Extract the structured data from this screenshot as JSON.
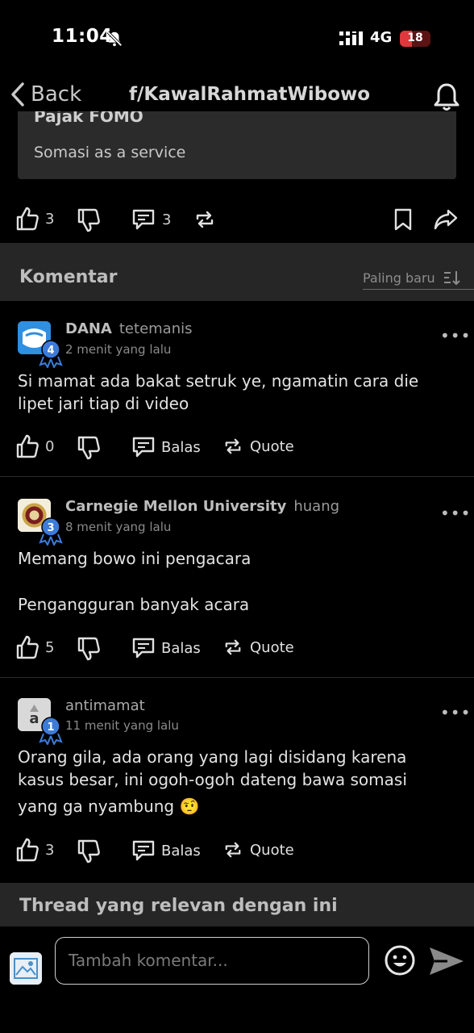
{
  "status": {
    "time": "11:04",
    "network": "4G",
    "battery": "18"
  },
  "nav": {
    "back_label": "Back",
    "title": "f/KawalRahmatWibowo"
  },
  "post": {
    "card_title_cut": "Pajak FOMO",
    "card_text": "Somasi as a service",
    "likes": "3",
    "comments": "3"
  },
  "comments_section": {
    "title": "Komentar",
    "sort_label": "Paling baru"
  },
  "comments": [
    {
      "author": "DANA",
      "username": "tetemanis",
      "time": "2 menit yang lalu",
      "badge_level": "4",
      "body": [
        "Si mamat ada bakat setruk ye, ngamatin cara die",
        "lipet jari tiap di video"
      ],
      "likes": "0",
      "reply_label": "Balas",
      "quote_label": "Quote"
    },
    {
      "author": "Carnegie Mellon University",
      "username": "huang",
      "time": "8 menit yang lalu",
      "badge_level": "3",
      "body": [
        "Memang bowo ini pengacara",
        "Pengangguran banyak acara"
      ],
      "likes": "5",
      "reply_label": "Balas",
      "quote_label": "Quote"
    },
    {
      "author": "",
      "username": "antimamat",
      "avatar_letter": "a",
      "time": "11 menit yang lalu",
      "badge_level": "1",
      "body": [
        "Orang gila, ada orang yang lagi disidang karena",
        "kasus besar, ini ogoh-ogoh dateng bawa somasi",
        "yang ga nyambung 🤨"
      ],
      "likes": "3",
      "reply_label": "Balas",
      "quote_label": "Quote"
    }
  ],
  "related": {
    "title": "Thread yang relevan dengan ini"
  },
  "composer": {
    "placeholder": "Tambah komentar..."
  },
  "colors": {
    "background": "#000000",
    "card": "#2b2b2b",
    "section": "#262626",
    "badge": "#3d7bd9",
    "battery": "#e0383c"
  }
}
